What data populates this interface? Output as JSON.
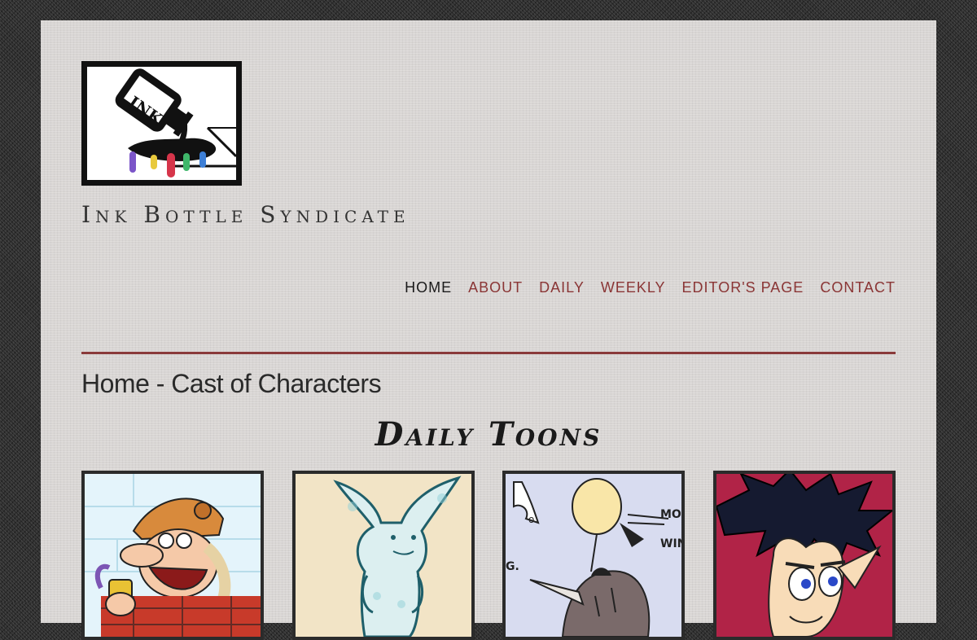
{
  "site": {
    "title": "Ink Bottle Syndicate",
    "logo_icon": "ink-bottle-spill-icon",
    "logo_text": "INK"
  },
  "nav": {
    "items": [
      {
        "label": "HOME",
        "active": true
      },
      {
        "label": "ABOUT",
        "active": false
      },
      {
        "label": "DAILY",
        "active": false
      },
      {
        "label": "WEEKLY",
        "active": false
      },
      {
        "label": "EDITOR'S PAGE",
        "active": false
      },
      {
        "label": "CONTACT",
        "active": false
      }
    ]
  },
  "page": {
    "heading": "Home - Cast of Characters"
  },
  "section": {
    "heading": "Daily Toons"
  },
  "thumbnails": {
    "items": [
      {
        "character": "laughing-man-in-hat-icon"
      },
      {
        "character": "rabbit-character-icon"
      },
      {
        "character": "balloon-bird-icon",
        "text_top": "MO",
        "text_bottom": "WIN",
        "text_left": "G."
      },
      {
        "character": "spiky-haired-face-icon"
      }
    ]
  },
  "colors": {
    "accent": "#8a3535",
    "rule": "#8a3a3a",
    "nav_active": "#1a1a1a",
    "page_bg": "#d9d6d4",
    "outer_bg": "#2a2a2a"
  }
}
